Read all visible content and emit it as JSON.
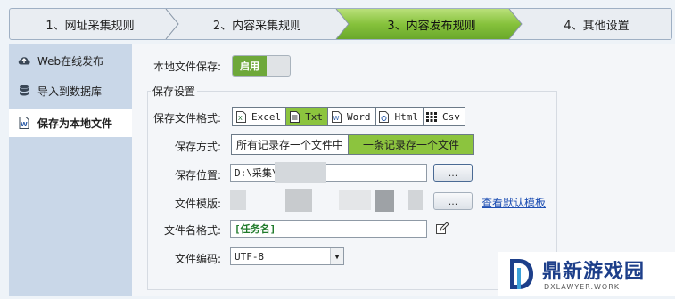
{
  "steps": [
    {
      "label": "1、网址采集规则"
    },
    {
      "label": "2、内容采集规则"
    },
    {
      "label": "3、内容发布规则"
    },
    {
      "label": "4、其他设置"
    }
  ],
  "sidebar": {
    "items": [
      {
        "label": "Web在线发布",
        "icon": "cloud-upload-icon"
      },
      {
        "label": "导入到数据库",
        "icon": "database-icon"
      },
      {
        "label": "保存为本地文件",
        "icon": "document-icon"
      }
    ]
  },
  "main": {
    "local_save_label": "本地文件保存:",
    "toggle_label": "启用",
    "group_title": "保存设置",
    "format_label": "保存文件格式:",
    "formats": [
      {
        "label": "Excel",
        "icon": "excel-icon"
      },
      {
        "label": "Txt",
        "icon": "txt-icon"
      },
      {
        "label": "Word",
        "icon": "word-icon"
      },
      {
        "label": "Html",
        "icon": "html-icon"
      },
      {
        "label": "Csv",
        "icon": "csv-icon"
      }
    ],
    "mode_label": "保存方式:",
    "modes": [
      "所有记录存一个文件中",
      "一条记录存一个文件"
    ],
    "location_label": "保存位置:",
    "location_value": "D:\\采集\\",
    "browse_label": "...",
    "template_label": "文件模版:",
    "template_browse_label": "...",
    "view_default_template": "查看默认模板",
    "filename_label": "文件名格式:",
    "filename_value": "[任务名]",
    "encoding_label": "文件编码:",
    "encoding_value": "UTF-8"
  },
  "watermark": {
    "title": "鼎新游戏园",
    "subtitle": "DXLAWYER.WORK"
  },
  "colors": {
    "accent": "#8cc43e",
    "active_step": "#7bbd2a",
    "link": "#1e4fb3"
  }
}
